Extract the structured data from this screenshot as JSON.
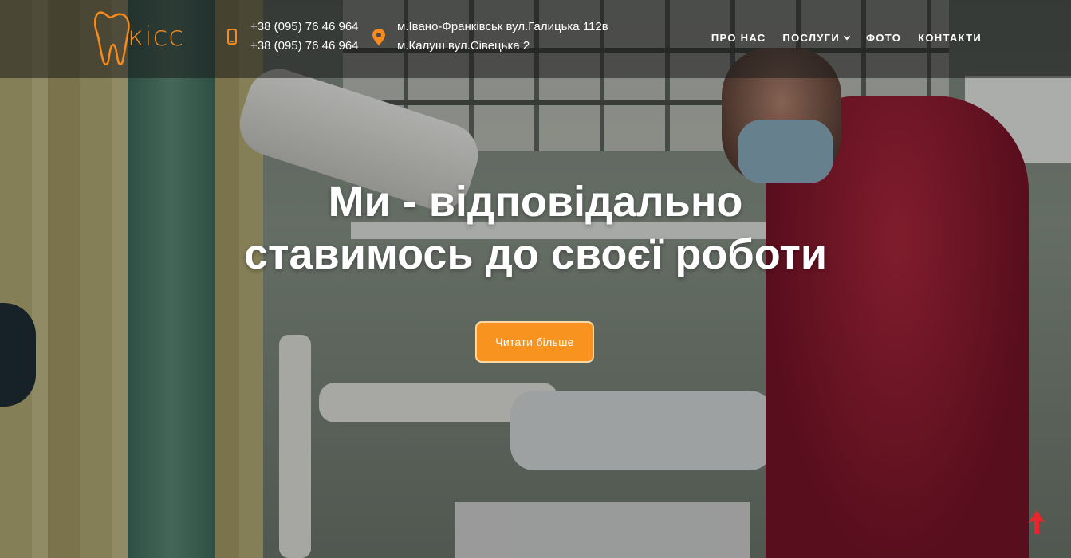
{
  "brand": {
    "logo_text": "кісс",
    "accent": "#f78b1e"
  },
  "contacts": {
    "phones": [
      "+38 (095) 76 46 964",
      "+38 (095) 76 46 964"
    ],
    "addresses": [
      "м.Івано-Франківськ вул.Галицька 112в",
      "м.Калуш вул.Сівецька 2"
    ],
    "phone_icon": "phone-icon",
    "address_icon": "map-pin-icon"
  },
  "nav": {
    "items": [
      {
        "label": "ПРО НАС"
      },
      {
        "label": "ПОСЛУГИ",
        "dropdown": true
      },
      {
        "label": "ФОТО"
      },
      {
        "label": "КОНТАКТИ"
      }
    ]
  },
  "hero": {
    "title": "Ми - відповідально ставимось до своєї роботи",
    "cta_label": "Читати більше",
    "cta_color": "#f7931e"
  },
  "scroll_top": {
    "icon": "arrow-up-icon",
    "color": "#e8262b"
  }
}
